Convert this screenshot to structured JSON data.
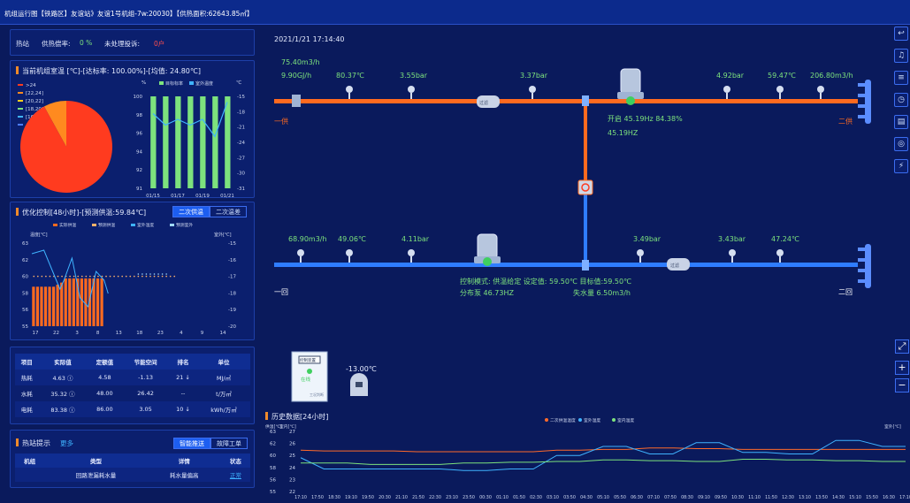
{
  "header": {
    "title": "机组运行图【铁路区】友谊站》友谊1号机组-7w:20030】【供热面积:62643.85㎡】"
  },
  "status_bar": {
    "section": "热站",
    "rate_label": "供热偿率:",
    "rate_value": "0 %",
    "complaint_label": "未处理投诉:",
    "complaint_value": "0户"
  },
  "unit_temp": {
    "title": "当前机组室温 [℃]-[达标率: 100.00%]-[均值: 24.80℃]",
    "legend": [
      ">24",
      "[22,24]",
      "[20,22]",
      "[18,20]",
      "[16,18]",
      "<16"
    ],
    "legend_colors": [
      "#ff3b1f",
      "#ff8a1f",
      "#ffd01f",
      "#7de27d",
      "#3fb3ff",
      "#4d7dff"
    ],
    "pie": [
      {
        "label": ">24",
        "value": 92
      },
      {
        "label": "[22,24]",
        "value": 8
      }
    ],
    "bar_legend": [
      "目标标率",
      "室外温度"
    ],
    "bar_unit_left": "%",
    "bar_unit_right": "℃",
    "bar_yticks_left": [
      "100",
      "98",
      "96",
      "94",
      "92",
      "91"
    ],
    "bar_yticks_right": [
      "-15",
      "-18",
      "-21",
      "-24",
      "-27",
      "-30",
      "-31"
    ],
    "bar_xticks": [
      "01/15",
      "01/17",
      "01/19",
      "01/21"
    ]
  },
  "opt": {
    "title": "优化控制[48小时]-[预测供温:59.84℃]",
    "tab_a": "二次供温",
    "tab_b": "二次温差",
    "legend": [
      "实际供温",
      "预测供温",
      "室外温度",
      "预测室外"
    ],
    "yl_label": "温度[℃]",
    "yr_label": "室外[℃]",
    "yticks_left": [
      "63",
      "62",
      "60",
      "58",
      "56",
      "55"
    ],
    "yticks_right": [
      "-15",
      "-16",
      "-17",
      "-18",
      "-19",
      "-20"
    ],
    "xticks": [
      "17",
      "22",
      "3",
      "8",
      "13",
      "18",
      "23",
      "4",
      "9",
      "14"
    ]
  },
  "stats": {
    "headers": [
      "项目",
      "实际值",
      "定额值",
      "节能空间",
      "排名",
      "单位"
    ],
    "rows": [
      [
        "热耗",
        "4.63 ⓘ",
        "4.58",
        "-1.13",
        "21 ↓",
        "MJ/㎡"
      ],
      [
        "水耗",
        "35.32 ⓘ",
        "48.00",
        "26.42",
        "--",
        "t/万㎡"
      ],
      [
        "电耗",
        "83.38 ⓘ",
        "86.00",
        "3.05",
        "10 ↓",
        "kWh/万㎡"
      ]
    ]
  },
  "alarm": {
    "title": "热站提示",
    "more": "更多",
    "tab_a": "智能推送",
    "tab_b": "故障工单",
    "headers": [
      "机组",
      "类型",
      "详情",
      "状态"
    ],
    "row": [
      "",
      "回路泄漏耗水量",
      "耗水量偏高",
      "正常"
    ]
  },
  "diagram": {
    "timestamp": "2021/1/21 17:14:40",
    "supply_flow": "75.40m3/h",
    "supply_heat": "9.90GJ/h",
    "t1": "80.37℃",
    "p1": "3.55bar",
    "p2": "3.37bar",
    "p3": "4.92bar",
    "t2": "59.47℃",
    "flow2": "206.80m3/h",
    "primary_supply": "一供",
    "secondary_supply": "二供",
    "pump_info": "开启 45.19Hz 84.38%",
    "pump_hz": "45.19HZ",
    "return_flow": "68.90m3/h",
    "t3": "49.06℃",
    "p4": "4.11bar",
    "p5": "3.49bar",
    "p6": "3.43bar",
    "t4": "47.24℃",
    "primary_return": "一回",
    "secondary_return": "二回",
    "mode": "控制模式: 供温给定 设定值: 59.50℃ 目标值:59.50℃",
    "dist_pump": "分布泵  46.73HZ",
    "loss": "失水量  6.50m3/h",
    "outdoor": "-13.00℃",
    "ctrl_box_title": "控制装置",
    "ctrl_box_status": "在线",
    "ctrl_box_footer": "工况判断",
    "filter_label": "过滤"
  },
  "history": {
    "title": "历史数据[24小时]",
    "legend": [
      "二次供温温度",
      "室外温度",
      "室内温度"
    ],
    "legend_colors": [
      "#ff6a2a",
      "#3fb3ff",
      "#7de27d"
    ],
    "yl_label": "供温[℃]",
    "yl2_label": "室内[℃]",
    "yr_label": "室外[℃]",
    "yticks_a": [
      "63",
      "62",
      "60",
      "58",
      "56",
      "55"
    ],
    "yticks_b": [
      "27",
      "26",
      "25",
      "24",
      "23",
      "22"
    ],
    "xticks": [
      "17:10",
      "17:50",
      "18:30",
      "19:10",
      "19:50",
      "20:30",
      "21:10",
      "21:50",
      "22:30",
      "23:10",
      "23:50",
      "00:30",
      "01:10",
      "01:50",
      "02:30",
      "03:10",
      "03:50",
      "04:30",
      "05:10",
      "05:50",
      "06:30",
      "07:10",
      "07:50",
      "08:30",
      "09:10",
      "09:50",
      "10:30",
      "11:10",
      "11:50",
      "12:30",
      "13:10",
      "13:50",
      "14:30",
      "15:10",
      "15:50",
      "16:30",
      "17:10"
    ]
  },
  "chart_data": [
    {
      "type": "pie",
      "title": "当前机组室温 [℃]-[达标率: 100.00%]-[均值: 24.80℃]",
      "slices": [
        {
          "label": ">24",
          "value": 92
        },
        {
          "label": "[22,24]",
          "value": 8
        }
      ]
    },
    {
      "type": "bar",
      "categories": [
        "01/15",
        "01/16",
        "01/17",
        "01/18",
        "01/19",
        "01/20",
        "01/21"
      ],
      "series": [
        {
          "name": "目标标率",
          "values": [
            100,
            100,
            100,
            100,
            100,
            100,
            100
          ]
        },
        {
          "name": "室外温度",
          "values": [
            -18,
            -20,
            -19,
            -20,
            -19,
            -22,
            -16
          ]
        }
      ],
      "ylim": [
        91,
        100
      ]
    },
    {
      "type": "bar",
      "title": "优化控制[48小时]-[预测供温:59.84℃]",
      "categories": [
        "17",
        "18",
        "19",
        "20",
        "21",
        "22",
        "23",
        "0",
        "1",
        "2",
        "3",
        "4",
        "5",
        "6",
        "7",
        "8",
        "9",
        "10"
      ],
      "series": [
        {
          "name": "实际供温",
          "values": [
            58.8,
            58.8,
            58.8,
            58.8,
            58.8,
            58.8,
            59.0,
            59.2,
            59.6,
            59.6,
            59.6,
            59.6,
            59.6,
            59.6,
            59.6,
            59.6,
            59.6,
            59.6
          ]
        }
      ],
      "ylim": [
        55,
        63
      ]
    },
    {
      "type": "line",
      "title": "历史数据[24小时]",
      "series": [
        {
          "name": "二次供温温度",
          "values": [
            60.5,
            60.4,
            60.4,
            60.3,
            60.3,
            60.3,
            60.5,
            60.6,
            60.8,
            60.7,
            60.6,
            60.6,
            60.6,
            60.6
          ]
        },
        {
          "name": "室外温度",
          "values": [
            59.5,
            58.0,
            58.0,
            58.0,
            57.8,
            58.0,
            59.8,
            61.0,
            60.0,
            61.5,
            60.2,
            60.0,
            61.8,
            61.0
          ]
        },
        {
          "name": "室内温度",
          "values": [
            58.8,
            58.8,
            58.6,
            58.6,
            58.8,
            58.9,
            59.0,
            59.2,
            59.1,
            59.0,
            59.3,
            59.2,
            59.1,
            59.0
          ]
        }
      ],
      "ylim": [
        55,
        63
      ]
    }
  ]
}
